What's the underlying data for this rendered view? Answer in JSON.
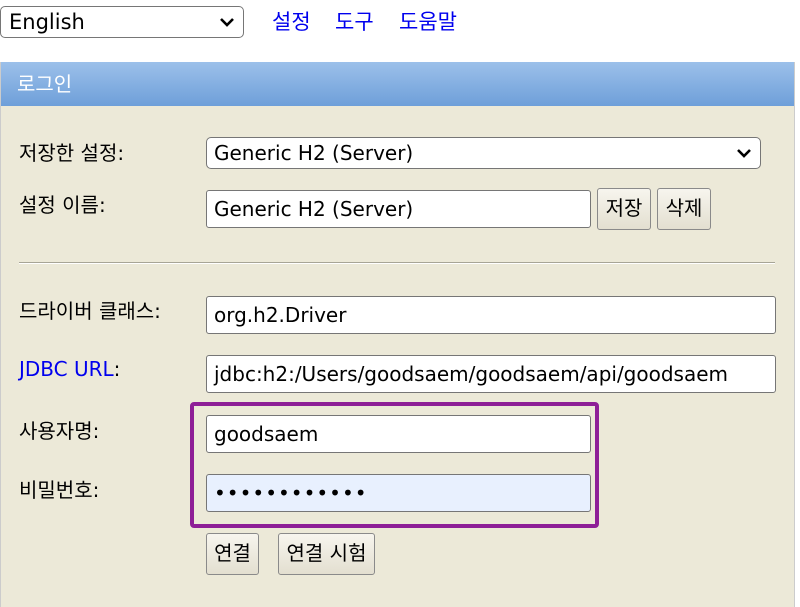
{
  "top": {
    "language_select": {
      "value": "English"
    },
    "links": [
      "설정",
      "도구",
      "도움말"
    ]
  },
  "panel": {
    "title": "로그인",
    "saved_settings": {
      "label": "저장한 설정:",
      "value": "Generic H2 (Server)"
    },
    "setting_name": {
      "label": "설정 이름:",
      "value": "Generic H2 (Server)"
    },
    "save_button": "저장",
    "delete_button": "삭제",
    "driver_class": {
      "label": "드라이버 클래스:",
      "value": "org.h2.Driver"
    },
    "jdbc_url": {
      "label_link": "JDBC URL",
      "label_suffix": ":",
      "value": "jdbc:h2:/Users/goodsaem/goodsaem/api/goodsaem"
    },
    "username": {
      "label": "사용자명:",
      "value": "goodsaem"
    },
    "password": {
      "label": "비밀번호:",
      "value": "••••••••••••"
    },
    "connect_button": "연결",
    "test_connection_button": "연결 시험"
  },
  "colors": {
    "header_gradient_top": "#9cc0ea",
    "header_gradient_bottom": "#6e9fd9",
    "panel_bg": "#ece9d8",
    "link": "#0000ee",
    "highlight_border": "#8e1f97"
  }
}
